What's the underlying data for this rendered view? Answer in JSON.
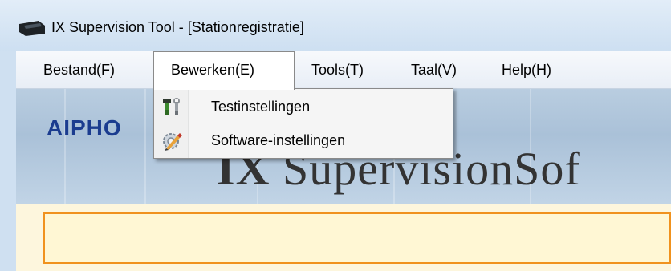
{
  "window": {
    "title": "IX Supervision Tool - [Stationregistratie]"
  },
  "menubar": {
    "items": [
      {
        "label": "Bestand(F)"
      },
      {
        "label": "Bewerken(E)"
      },
      {
        "label": "Tools(T)"
      },
      {
        "label": "Taal(V)"
      },
      {
        "label": "Help(H)"
      }
    ]
  },
  "dropdown": {
    "items": [
      {
        "label": "Testinstellingen",
        "icon": "tools-icon"
      },
      {
        "label": "Software-instellingen",
        "icon": "gear-icon"
      }
    ]
  },
  "banner": {
    "brand": "AIPHO",
    "product_bold": "IX",
    "product_rest": " SupervisionSof"
  },
  "colors": {
    "status_border": "#f0921e",
    "status_fill": "#fff7d4",
    "brand": "#1b3c8f"
  }
}
